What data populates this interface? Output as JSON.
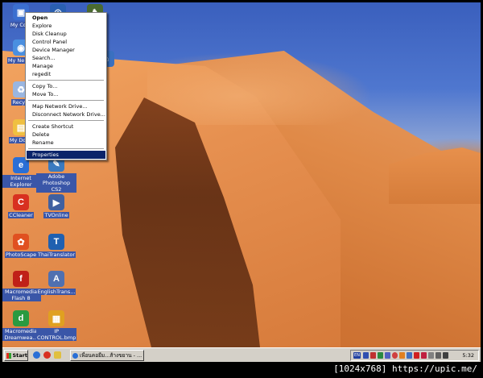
{
  "desktop": {
    "icons": [
      {
        "label": "My Com",
        "color": "#3b6fd0"
      },
      {
        "label": "My Ne Pla",
        "color": "#4a8fe0"
      },
      {
        "label": "Recycl",
        "color": "#9ab6e0"
      },
      {
        "label": "My Docu",
        "color": "#f0c040"
      },
      {
        "label": "Internet Explorer",
        "color": "#2a6fd6"
      },
      {
        "label": "Adobe Photoshop CS2",
        "color": "#3a7ac0"
      },
      {
        "label": "CCleaner",
        "color": "#d83020"
      },
      {
        "label": "TVOnline",
        "color": "#4060a0"
      },
      {
        "label": "PhotoScape",
        "color": "#e05020"
      },
      {
        "label": "ThaiTranslator",
        "color": "#2060b0"
      },
      {
        "label": "Macromedia Flash 8",
        "color": "#c02018"
      },
      {
        "label": "EnglishTrans...",
        "color": "#5070b0"
      },
      {
        "label": "Macromedia Dreamwea...",
        "color": "#2a9a40"
      },
      {
        "label": "IP CONTROL.bmp",
        "color": "#e0a020"
      }
    ]
  },
  "context_menu": {
    "items": [
      {
        "label": "Open",
        "bold": true
      },
      {
        "label": "Explore"
      },
      {
        "label": "Disk Cleanup"
      },
      {
        "label": "Control Panel"
      },
      {
        "label": "Device Manager"
      },
      {
        "label": "Search..."
      },
      {
        "label": "Manage"
      },
      {
        "label": "regedit"
      },
      {
        "label": "Copy To..."
      },
      {
        "label": "Move To..."
      },
      {
        "label": "Map Network Drive..."
      },
      {
        "label": "Disconnect Network Drive..."
      },
      {
        "label": "Create Shortcut"
      },
      {
        "label": "Delete"
      },
      {
        "label": "Rename"
      },
      {
        "label": "Properties",
        "selected": true
      }
    ]
  },
  "taskbar": {
    "start_label": "Start",
    "task_button_label": "เพื่อนคอยืม...ส้างขยาน - ...",
    "clock": "5:32",
    "tray_language": "EN"
  },
  "watermark": "[1024x768] https://upic.me/"
}
